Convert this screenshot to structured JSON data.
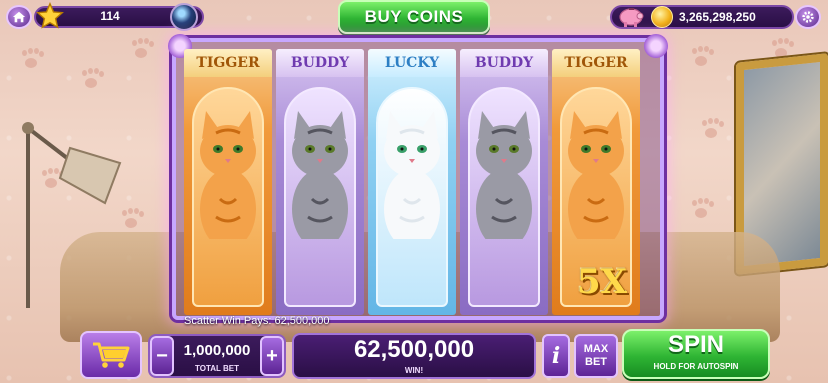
{
  "topbar": {
    "level": "114",
    "buy_coins_label": "BUY COINS",
    "coin_balance": "3,265,298,250"
  },
  "reels": [
    {
      "name": "TIGGER",
      "theme": "orange",
      "cat": "orange-tabby"
    },
    {
      "name": "BUDDY",
      "theme": "purple",
      "cat": "grey-tabby"
    },
    {
      "name": "LUCKY",
      "theme": "blue",
      "cat": "white-persian"
    },
    {
      "name": "BUDDY",
      "theme": "purple",
      "cat": "grey-tabby"
    },
    {
      "name": "TIGGER",
      "theme": "orange",
      "cat": "orange-tabby"
    }
  ],
  "multiplier": "5X",
  "scatter_text": "Scatter Win Pays: 62,500,000",
  "bet": {
    "minus_label": "−",
    "plus_label": "+",
    "value": "1,000,000",
    "label": "TOTAL BET"
  },
  "win": {
    "value": "62,500,000",
    "label": "WIN!"
  },
  "info_label": "i",
  "max_bet": {
    "line1": "MAX",
    "line2": "BET"
  },
  "spin": {
    "label": "SPIN",
    "sub_label": "HOLD FOR AUTOSPIN"
  },
  "colors": {
    "accent_purple": "#6e2fa0",
    "accent_green": "#2fb534",
    "gold": "#ffd94a"
  }
}
